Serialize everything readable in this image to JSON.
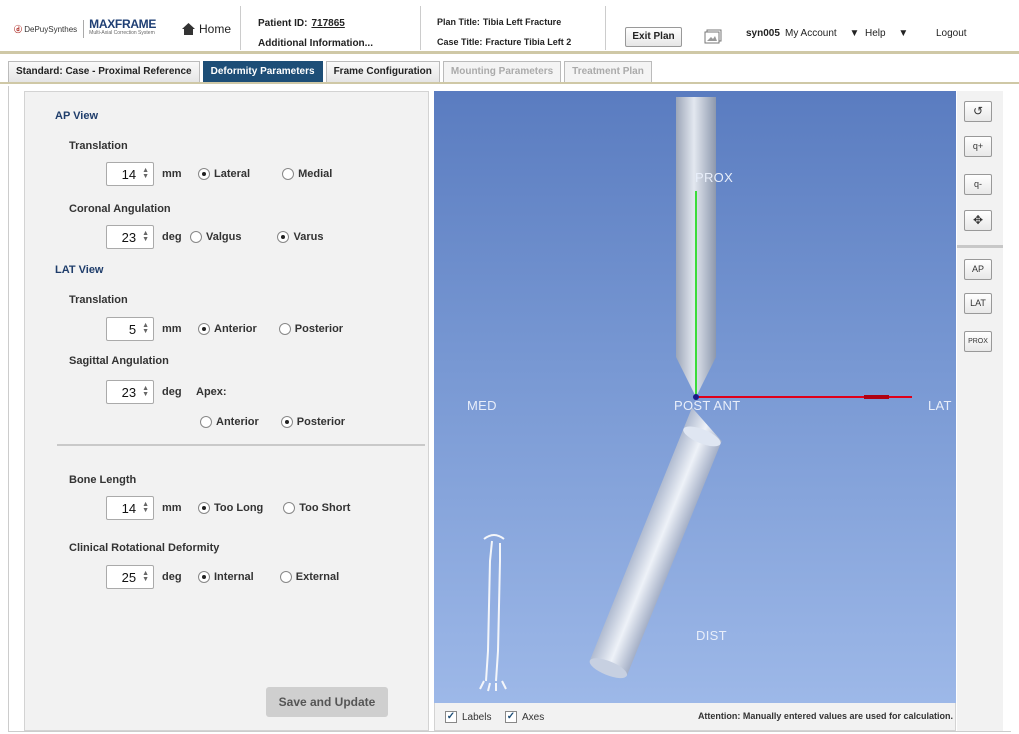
{
  "header": {
    "logo_brand": "DePuySynthes",
    "logo_product": "MAXFRAME",
    "logo_tagline": "Multi-Axial Correction System",
    "home_label": "Home",
    "patient_id_label": "Patient ID:",
    "patient_id_value": "717865",
    "additional_info": "Additional Information...",
    "plan_title_label": "Plan Title:",
    "plan_title_value": "Tibia Left Fracture",
    "case_title_label": "Case Title:",
    "case_title_value": "Fracture Tibia Left 2",
    "exit_plan": "Exit Plan",
    "username": "syn005",
    "my_account": "My Account",
    "help": "Help",
    "dropdown_glyph": "▼",
    "logout": "Logout"
  },
  "tabs": [
    {
      "label": "Standard: Case - Proximal Reference",
      "state": "normal"
    },
    {
      "label": "Deformity Parameters",
      "state": "active"
    },
    {
      "label": "Frame Configuration",
      "state": "normal"
    },
    {
      "label": "Mounting Parameters",
      "state": "disabled"
    },
    {
      "label": "Treatment Plan",
      "state": "disabled"
    }
  ],
  "form": {
    "ap_view": "AP View",
    "translation": "Translation",
    "ap_translation_value": "14",
    "ap_translation_unit": "mm",
    "lateral": "Lateral",
    "medial": "Medial",
    "coronal_angulation": "Coronal Angulation",
    "coronal_value": "23",
    "coronal_unit": "deg",
    "valgus": "Valgus",
    "varus": "Varus",
    "lat_view": "LAT View",
    "lat_translation_value": "5",
    "lat_translation_unit": "mm",
    "anterior": "Anterior",
    "posterior": "Posterior",
    "sagittal_angulation": "Sagittal Angulation",
    "sagittal_value": "23",
    "sagittal_unit": "deg",
    "apex": "Apex:",
    "bone_length": "Bone Length",
    "bone_length_value": "14",
    "bone_length_unit": "mm",
    "too_long": "Too Long",
    "too_short": "Too Short",
    "clinical_rotation": "Clinical Rotational Deformity",
    "rotation_value": "25",
    "rotation_unit": "deg",
    "internal": "Internal",
    "external": "External",
    "save_update": "Save and Update"
  },
  "view": {
    "prox": "PROX",
    "dist": "DIST",
    "med": "MED",
    "lat": "LAT",
    "post_ant": "POST ANT",
    "labels_chk": "Labels",
    "axes_chk": "Axes",
    "attention": "Attention: Manually entered values are used for calculation.",
    "colors": {
      "bg_top": "#5a7cc0",
      "bg_bottom": "#9db8e8",
      "axis_x": "#e0001a",
      "axis_y": "#3cdc3c"
    }
  },
  "toolbar": {
    "reset_icon": "↺",
    "zoom_in_icon": "q+",
    "zoom_out_icon": "q-",
    "pan_icon": "✥",
    "ap": "AP",
    "lat": "LAT",
    "prox": "PROX"
  },
  "check_glyph": "✓"
}
